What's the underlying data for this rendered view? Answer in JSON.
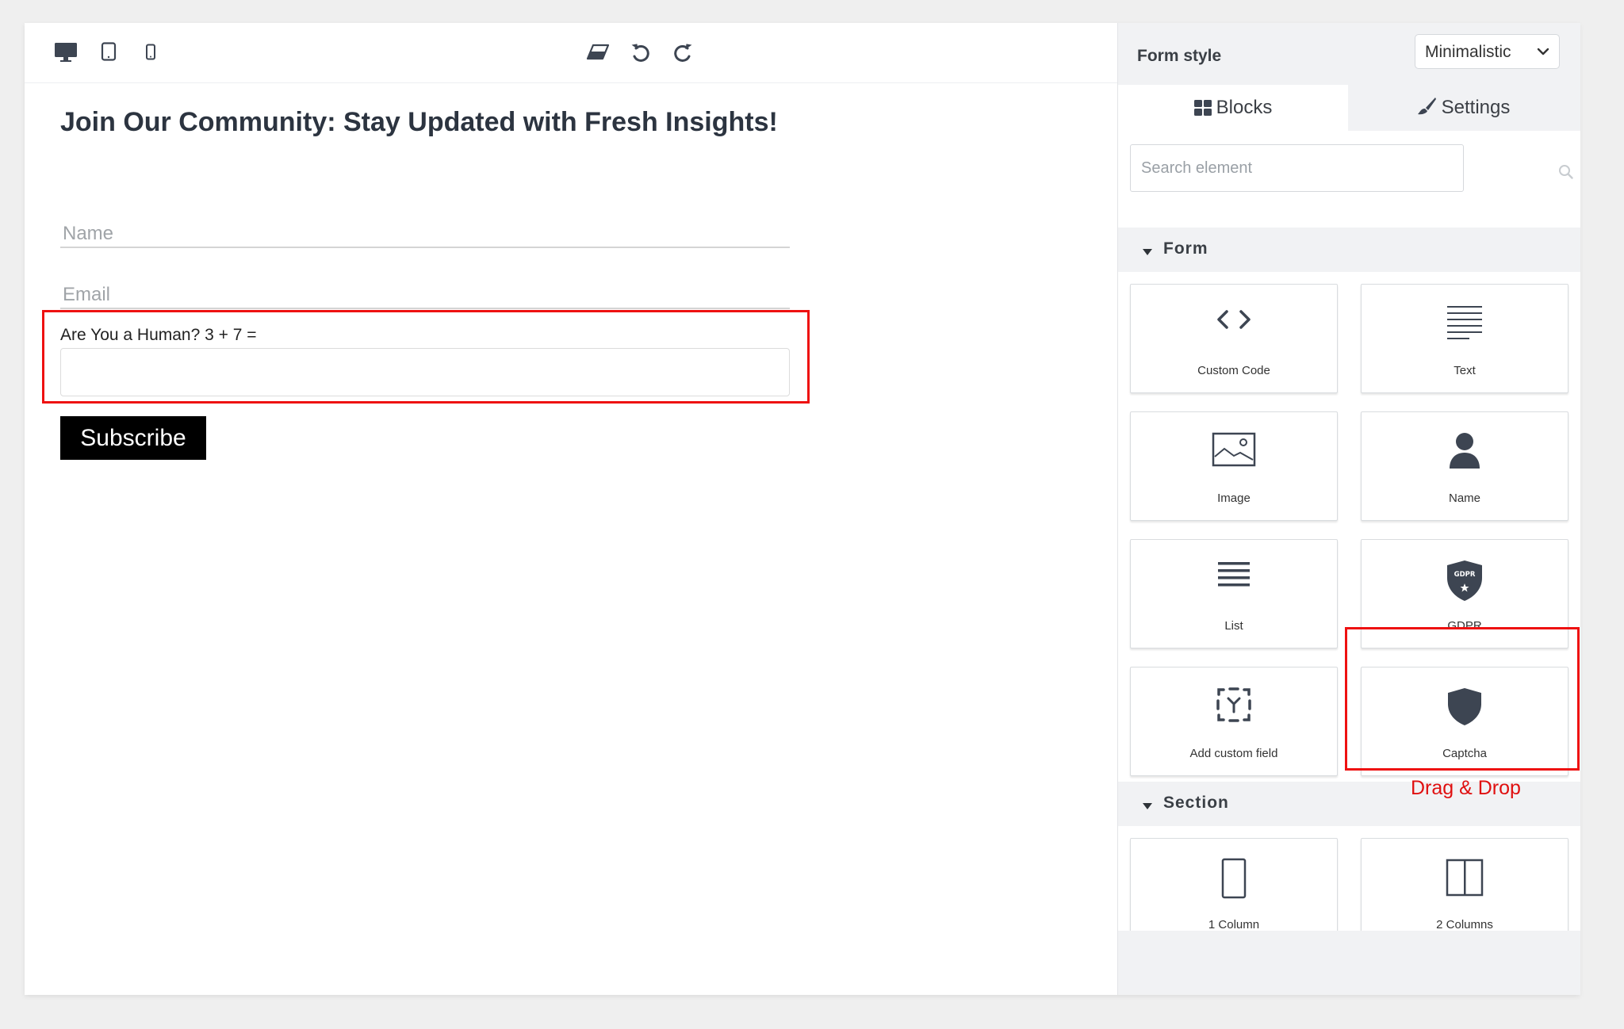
{
  "toolbar": {
    "devices": [
      "desktop-icon",
      "tablet-icon",
      "mobile-icon"
    ],
    "actions": [
      "eraser-icon",
      "undo-icon",
      "redo-icon"
    ]
  },
  "form": {
    "title": "Join Our Community: Stay Updated with Fresh Insights!",
    "name_placeholder": "Name",
    "email_placeholder": "Email",
    "captcha_label": "Are You a Human? 3 + 7 =",
    "captcha_value": "",
    "subscribe_label": "Subscribe"
  },
  "sidebar": {
    "form_style_label": "Form style",
    "form_style_value": "Minimalistic",
    "tabs": [
      {
        "label": "Blocks",
        "icon": "grid-icon",
        "active": true
      },
      {
        "label": "Settings",
        "icon": "brush-icon",
        "active": false
      }
    ],
    "search_placeholder": "Search element",
    "sections": [
      {
        "label": "Form",
        "blocks": [
          {
            "label": "Custom Code",
            "icon": "code-icon"
          },
          {
            "label": "Text",
            "icon": "text-lines-icon"
          },
          {
            "label": "Image",
            "icon": "image-icon"
          },
          {
            "label": "Name",
            "icon": "person-icon"
          },
          {
            "label": "List",
            "icon": "list-icon"
          },
          {
            "label": "GDPR",
            "icon": "gdpr-shield-icon"
          },
          {
            "label": "Add custom field",
            "icon": "custom-field-icon"
          },
          {
            "label": "Captcha",
            "icon": "shield-icon"
          }
        ]
      },
      {
        "label": "Section",
        "blocks": [
          {
            "label": "1 Column",
            "icon": "one-column-icon"
          },
          {
            "label": "2 Columns",
            "icon": "two-columns-icon"
          }
        ]
      }
    ]
  },
  "annotation": {
    "drag_note": "Drag & Drop",
    "highlight_color": "#e11111"
  },
  "colors": {
    "icon": "#3d4552",
    "button_bg": "#000000",
    "sidebar_bg": "#f1f2f4"
  }
}
